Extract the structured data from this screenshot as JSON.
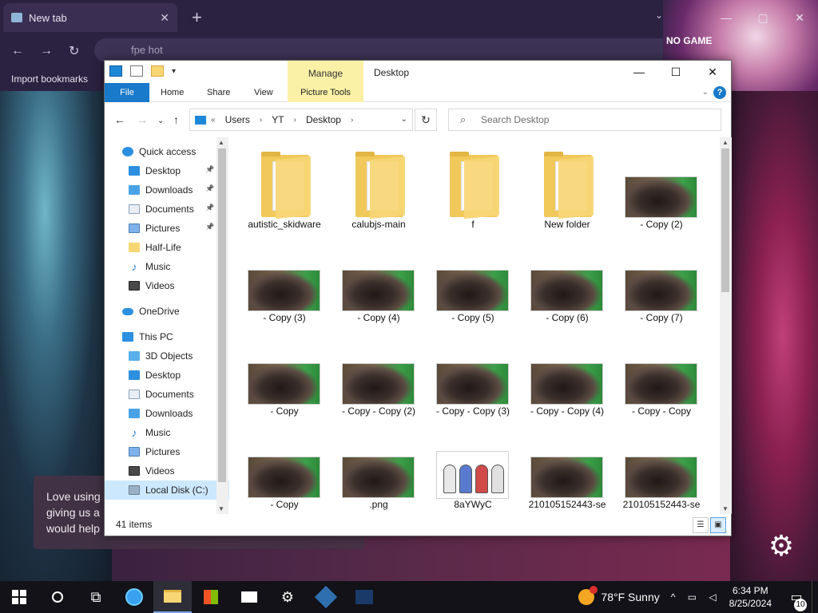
{
  "browser": {
    "tab_title": "New tab",
    "tab_close": "✕",
    "new_tab": "+",
    "omnibox_text": "fpe hot",
    "bookmarks_label": "Import bookmarks",
    "banner_text": "NO GAME",
    "controls": {
      "minimize": "—",
      "maximize": "▢",
      "close": "✕"
    },
    "tab_dropdown": "⌄"
  },
  "toast": {
    "line1": "Love using",
    "line2": "giving us a",
    "line3": "would help"
  },
  "explorer": {
    "title": "Desktop",
    "manage_label": "Manage",
    "window_controls": {
      "minimize": "—",
      "maximize": "☐",
      "close": "✕"
    },
    "ribbon_tabs": [
      "File",
      "Home",
      "Share",
      "View",
      "Picture Tools"
    ],
    "help": "?",
    "address": {
      "prefix": "«",
      "crumbs": [
        "Users",
        "YT",
        "Desktop"
      ],
      "sep": "›"
    },
    "search_placeholder": "Search Desktop",
    "refresh": "↻",
    "nav_buttons": {
      "back": "←",
      "forward": "→",
      "recent": "⌄",
      "up": "↑"
    },
    "nav_pane": [
      {
        "label": "Quick access",
        "icon": "star",
        "indent": 0,
        "pinned": false
      },
      {
        "label": "Desktop",
        "icon": "blue",
        "indent": 1,
        "pinned": true
      },
      {
        "label": "Downloads",
        "icon": "lightblue",
        "indent": 1,
        "pinned": true
      },
      {
        "label": "Documents",
        "icon": "doc",
        "indent": 1,
        "pinned": true
      },
      {
        "label": "Pictures",
        "icon": "pic",
        "indent": 1,
        "pinned": true
      },
      {
        "label": "Half-Life",
        "icon": "folder",
        "indent": 1,
        "pinned": false
      },
      {
        "label": "Music",
        "icon": "music",
        "indent": 1,
        "pinned": false
      },
      {
        "label": "Videos",
        "icon": "video",
        "indent": 1,
        "pinned": false
      },
      {
        "label": "",
        "icon": "",
        "indent": 0,
        "pinned": false,
        "spacer": true
      },
      {
        "label": "OneDrive",
        "icon": "cloud",
        "indent": 0,
        "pinned": false
      },
      {
        "label": "",
        "icon": "",
        "indent": 0,
        "pinned": false,
        "spacer": true
      },
      {
        "label": "This PC",
        "icon": "blue",
        "indent": 0,
        "pinned": false
      },
      {
        "label": "3D Objects",
        "icon": "cube",
        "indent": 1,
        "pinned": false
      },
      {
        "label": "Desktop",
        "icon": "blue",
        "indent": 1,
        "pinned": false
      },
      {
        "label": "Documents",
        "icon": "doc",
        "indent": 1,
        "pinned": false
      },
      {
        "label": "Downloads",
        "icon": "lightblue",
        "indent": 1,
        "pinned": false
      },
      {
        "label": "Music",
        "icon": "music",
        "indent": 1,
        "pinned": false
      },
      {
        "label": "Pictures",
        "icon": "pic",
        "indent": 1,
        "pinned": false
      },
      {
        "label": "Videos",
        "icon": "video",
        "indent": 1,
        "pinned": false
      },
      {
        "label": "Local Disk (C:)",
        "icon": "disk",
        "indent": 1,
        "pinned": false,
        "selected": true
      }
    ],
    "items": [
      {
        "label": "autistic_skidware",
        "kind": "folder"
      },
      {
        "label": "calubjs-main",
        "kind": "folder"
      },
      {
        "label": "f",
        "kind": "folder"
      },
      {
        "label": "New folder",
        "kind": "folder"
      },
      {
        "label": "- Copy (2)",
        "kind": "image"
      },
      {
        "label": "- Copy (3)",
        "kind": "image"
      },
      {
        "label": "- Copy (4)",
        "kind": "image"
      },
      {
        "label": "- Copy (5)",
        "kind": "image"
      },
      {
        "label": "- Copy (6)",
        "kind": "image"
      },
      {
        "label": "- Copy (7)",
        "kind": "image"
      },
      {
        "label": "- Copy",
        "kind": "image"
      },
      {
        "label": "- Copy - Copy (2)",
        "kind": "image"
      },
      {
        "label": "- Copy - Copy (3)",
        "kind": "image"
      },
      {
        "label": "- Copy - Copy (4)",
        "kind": "image"
      },
      {
        "label": "- Copy - Copy",
        "kind": "image"
      },
      {
        "label": "- Copy",
        "kind": "image"
      },
      {
        "label": ".png",
        "kind": "image"
      },
      {
        "label": "8aYWyC",
        "kind": "cartoon"
      },
      {
        "label": "210105152443-se",
        "kind": "image"
      },
      {
        "label": "210105152443-se",
        "kind": "image"
      }
    ],
    "status_count": "41 items"
  },
  "taskbar": {
    "weather_temp": "78°F",
    "weather_desc": "Sunny",
    "tray_icons": "^ ▭ ◁",
    "time": "6:34 PM",
    "date": "8/25/2024",
    "notif_count": "10"
  },
  "colors": {
    "accent": "#1979ca",
    "picture_tools": "#fbf1a6",
    "selected_nav": "#cce8ff",
    "taskbar": "#121218"
  }
}
